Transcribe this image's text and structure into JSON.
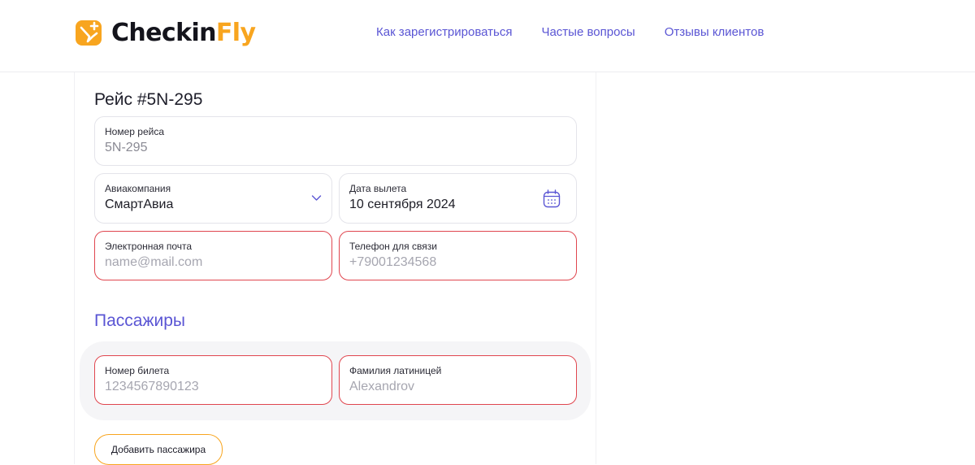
{
  "header": {
    "logo_text_dark": "Checkin",
    "logo_text_accent": "Fly",
    "nav": [
      {
        "label": "Как зарегистрироваться"
      },
      {
        "label": "Частые вопросы"
      },
      {
        "label": "Отзывы клиентов"
      }
    ]
  },
  "form": {
    "title": "Рейс #5N-295",
    "flight_number": {
      "label": "Номер рейса",
      "value": "5N-295"
    },
    "airline": {
      "label": "Авиакомпания",
      "value": "СмартАвиа",
      "icon": "chevron-down-icon"
    },
    "departure_date": {
      "label": "Дата вылета",
      "value": "10 сентября 2024",
      "icon": "calendar-icon"
    },
    "email": {
      "label": "Электронная почта",
      "placeholder": "name@mail.com"
    },
    "phone": {
      "label": "Телефон для связи",
      "placeholder": "+79001234568"
    }
  },
  "passengers": {
    "title": "Пассажиры",
    "ticket_number": {
      "label": "Номер билета",
      "placeholder": "1234567890123"
    },
    "last_name_latin": {
      "label": "Фамилия латиницей",
      "placeholder": "Alexandrov"
    },
    "add_button_label": "Добавить пассажира"
  },
  "colors": {
    "accent": "#f8a51f",
    "link": "#5a55d4",
    "error": "#e0464f"
  }
}
